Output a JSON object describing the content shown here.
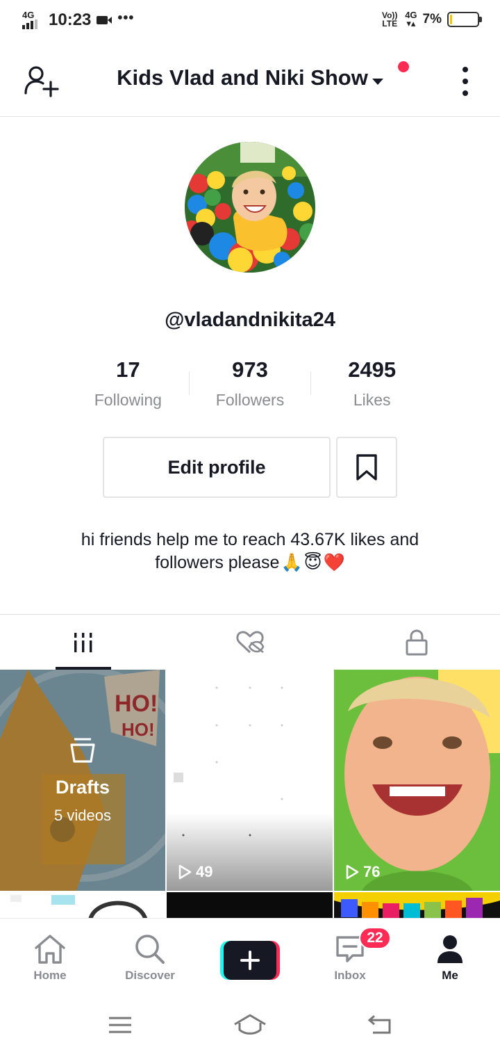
{
  "status_bar": {
    "network": "4G",
    "time": "10:23",
    "volte": "Vo)) LTE",
    "data_type": "4G",
    "battery_percent": "7%",
    "battery_level": 0.07
  },
  "header": {
    "title": "Kids Vlad and Niki Show",
    "notification_dot_color": "#fe2c55"
  },
  "profile": {
    "username": "@vladandnikita24",
    "stats": [
      {
        "value": "17",
        "label": "Following"
      },
      {
        "value": "973",
        "label": "Followers"
      },
      {
        "value": "2495",
        "label": "Likes"
      }
    ],
    "edit_button_label": "Edit profile",
    "bio_line1": "hi friends help me to reach 43.67K likes and",
    "bio_line2": "followers please",
    "bio_emojis": [
      "🙏",
      "😇",
      "❤️"
    ]
  },
  "tabs": [
    {
      "icon": "grid-icon",
      "active": true
    },
    {
      "icon": "liked-hidden-icon",
      "active": false
    },
    {
      "icon": "lock-icon",
      "active": false
    }
  ],
  "grid": {
    "drafts": {
      "title": "Drafts",
      "subtitle": "5 videos"
    },
    "videos": [
      {
        "plays": "49"
      },
      {
        "plays": "76"
      }
    ]
  },
  "bottom_nav": {
    "home": "Home",
    "discover": "Discover",
    "inbox": "Inbox",
    "inbox_badge": "22",
    "me": "Me"
  },
  "colors": {
    "accent": "#fe2c55",
    "cyan": "#25f4ee",
    "text": "#161823",
    "secondary_text": "#8a8b91"
  }
}
